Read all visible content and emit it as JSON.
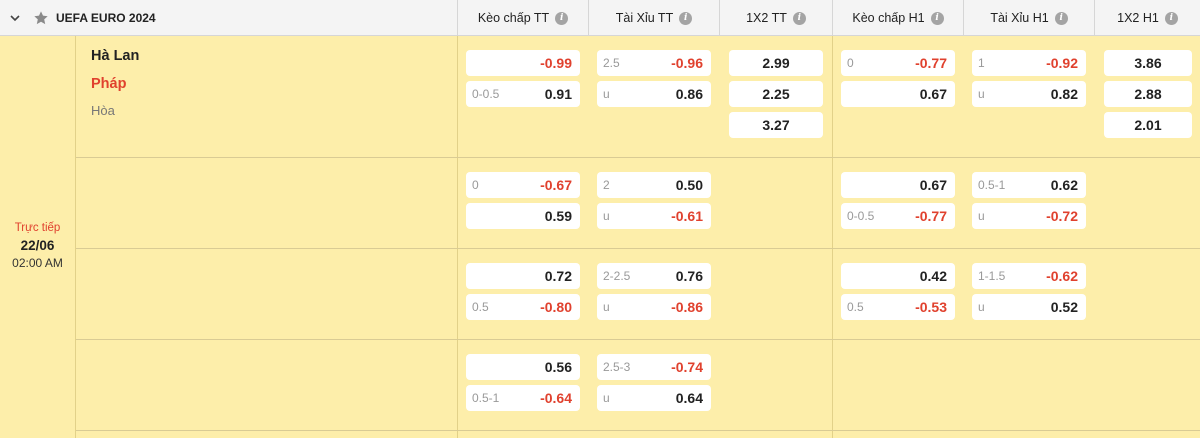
{
  "header": {
    "league": "UEFA EURO 2024",
    "columns": [
      "Kèo chấp TT",
      "Tài Xỉu TT",
      "1X2 TT",
      "Kèo chấp H1",
      "Tài Xỉu H1",
      "1X2 H1"
    ]
  },
  "match": {
    "status": "Trực tiếp",
    "date": "22/06",
    "time": "02:00 AM",
    "home": "Hà Lan",
    "away": "Pháp",
    "draw": "Hòa"
  },
  "rows": [
    {
      "hdp_ft": [
        {
          "line": "",
          "odds": "-0.99"
        },
        {
          "line": "0-0.5",
          "odds": "0.91"
        }
      ],
      "ou_ft": [
        {
          "line": "2.5",
          "odds": "-0.96"
        },
        {
          "line": "u",
          "odds": "0.86"
        }
      ],
      "x12_ft": [
        "2.99",
        "2.25",
        "3.27"
      ],
      "hdp_h1": [
        {
          "line": "0",
          "odds": "-0.77"
        },
        {
          "line": "",
          "odds": "0.67"
        }
      ],
      "ou_h1": [
        {
          "line": "1",
          "odds": "-0.92"
        },
        {
          "line": "u",
          "odds": "0.82"
        }
      ],
      "x12_h1": [
        "3.86",
        "2.88",
        "2.01"
      ]
    },
    {
      "hdp_ft": [
        {
          "line": "0",
          "odds": "-0.67"
        },
        {
          "line": "",
          "odds": "0.59"
        }
      ],
      "ou_ft": [
        {
          "line": "2",
          "odds": "0.50"
        },
        {
          "line": "u",
          "odds": "-0.61"
        }
      ],
      "hdp_h1": [
        {
          "line": "",
          "odds": "0.67"
        },
        {
          "line": "0-0.5",
          "odds": "-0.77"
        }
      ],
      "ou_h1": [
        {
          "line": "0.5-1",
          "odds": "0.62"
        },
        {
          "line": "u",
          "odds": "-0.72"
        }
      ]
    },
    {
      "hdp_ft": [
        {
          "line": "",
          "odds": "0.72"
        },
        {
          "line": "0.5",
          "odds": "-0.80"
        }
      ],
      "ou_ft": [
        {
          "line": "2-2.5",
          "odds": "0.76"
        },
        {
          "line": "u",
          "odds": "-0.86"
        }
      ],
      "hdp_h1": [
        {
          "line": "",
          "odds": "0.42"
        },
        {
          "line": "0.5",
          "odds": "-0.53"
        }
      ],
      "ou_h1": [
        {
          "line": "1-1.5",
          "odds": "-0.62"
        },
        {
          "line": "u",
          "odds": "0.52"
        }
      ]
    },
    {
      "hdp_ft": [
        {
          "line": "",
          "odds": "0.56"
        },
        {
          "line": "0.5-1",
          "odds": "-0.64"
        }
      ],
      "ou_ft": [
        {
          "line": "2.5-3",
          "odds": "-0.74"
        },
        {
          "line": "u",
          "odds": "0.64"
        }
      ]
    }
  ]
}
